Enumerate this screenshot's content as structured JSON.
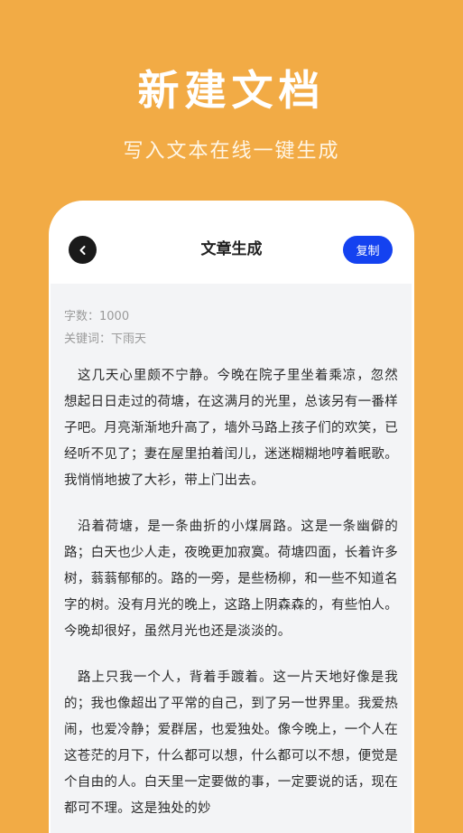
{
  "hero": {
    "title": "新建文档",
    "subtitle": "写入文本在线一键生成"
  },
  "nav": {
    "back_icon": "chevron-left-icon",
    "title": "文章生成",
    "copy_label": "复制"
  },
  "meta": {
    "word_count": "字数：1000",
    "keywords": "关键词：下雨天"
  },
  "article": {
    "paragraphs": [
      "这几天心里颇不宁静。今晚在院子里坐着乘凉，忽然想起日日走过的荷塘，在这满月的光里，总该另有一番样子吧。月亮渐渐地升高了，墙外马路上孩子们的欢笑，已经听不见了；妻在屋里拍着闰儿，迷迷糊糊地哼着眠歌。我悄悄地披了大衫，带上门出去。",
      "沿着荷塘，是一条曲折的小煤屑路。这是一条幽僻的路；白天也少人走，夜晚更加寂寞。荷塘四面，长着许多树，蓊蓊郁郁的。路的一旁，是些杨柳，和一些不知道名字的树。没有月光的晚上，这路上阴森森的，有些怕人。今晚却很好，虽然月光也还是淡淡的。",
      "路上只我一个人，背着手踱着。这一片天地好像是我的；我也像超出了平常的自己，到了另一世界里。我爱热闹，也爱冷静；爱群居，也爱独处。像今晚上，一个人在这苍茫的月下，什么都可以想，什么都可以不想，便觉是个自由的人。白天里一定要做的事，一定要说的话，现在都可不理。这是独处的妙"
    ]
  },
  "colors": {
    "background": "#F2AB45",
    "accent": "#1442F0",
    "content_bg": "#F3F4F6"
  }
}
